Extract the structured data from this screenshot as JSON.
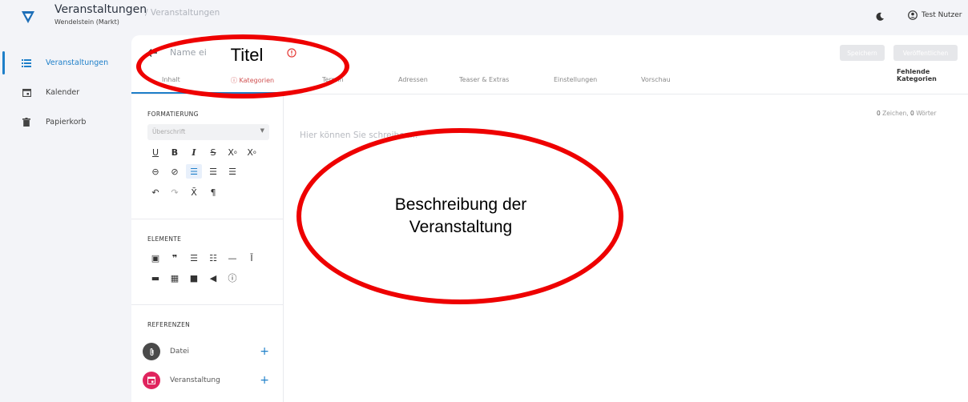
{
  "header": {
    "app_title": "Veranstaltungen",
    "app_subtitle": "Wendelstein (Markt)",
    "breadcrumb": "/ Veranstaltungen",
    "user_name": "Test Nutzer"
  },
  "sidebar": {
    "items": [
      {
        "label": "Veranstaltungen",
        "icon": "list-icon",
        "active": true
      },
      {
        "label": "Kalender",
        "icon": "calendar-icon",
        "active": false
      },
      {
        "label": "Papierkorb",
        "icon": "trash-icon",
        "active": false
      }
    ]
  },
  "editor": {
    "name_placeholder": "Name eingeben",
    "save_label": "Speichern",
    "publish_label": "Veröffentlichen",
    "missing_label": "Fehlende Kategorien",
    "tabs": [
      "Inhalt",
      "Kategorien",
      "Termin",
      "Adressen",
      "Teaser & Extras",
      "Einstellungen",
      "Vorschau"
    ],
    "counter": {
      "chars": "0",
      "chars_label": "Zeichen,",
      "words": "0",
      "words_label": "Wörter"
    },
    "body_placeholder": "Hier können Sie schreiben..."
  },
  "formatting": {
    "title": "FORMATIERUNG",
    "select_value": "Überschrift",
    "elements_title": "ELEMENTE",
    "references_title": "REFERENZEN",
    "references": [
      {
        "label": "Datei",
        "color": "#4a4a4a",
        "icon": "paperclip-icon"
      },
      {
        "label": "Veranstaltung",
        "color": "#e0245e",
        "icon": "calendar-icon"
      }
    ]
  },
  "annotations": {
    "title_label": "Titel",
    "desc_line1": "Beschreibung der",
    "desc_line2": "Veranstaltung",
    "color": "#ee0000"
  },
  "colors": {
    "accent": "#1e7fc9",
    "logo": "#1e6fb8"
  }
}
